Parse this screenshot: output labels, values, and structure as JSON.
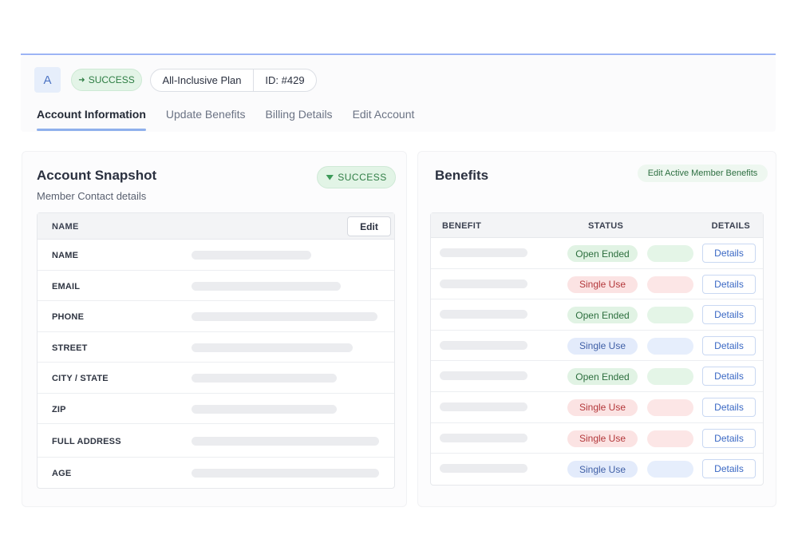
{
  "header": {
    "avatar_letter": "A",
    "status_label": "SUCCESS",
    "plan_name": "All-Inclusive Plan",
    "plan_id": "ID: #429",
    "tabs": [
      {
        "label": "Account Information",
        "active": true
      },
      {
        "label": "Update Benefits",
        "active": false
      },
      {
        "label": "Billing Details",
        "active": false
      },
      {
        "label": "Edit Account",
        "active": false
      }
    ]
  },
  "snapshot": {
    "title": "Account Snapshot",
    "subtitle": "Member Contact details",
    "status_label": "SUCCESS",
    "table_header": "NAME",
    "edit_label": "Edit",
    "rows": [
      "NAME",
      "EMAIL",
      "PHONE",
      "STREET",
      "CITY / STATE",
      "ZIP",
      "FULL ADDRESS",
      "AGE"
    ]
  },
  "benefits": {
    "title": "Benefits",
    "edit_label": "Edit Active Member Benefits",
    "columns": {
      "benefit": "BENEFIT",
      "status": "STATUS",
      "details": "DETAILS"
    },
    "rows": [
      {
        "status": "Open Ended",
        "tone": "open",
        "details": "Details"
      },
      {
        "status": "Single Use",
        "tone": "single",
        "details": "Details"
      },
      {
        "status": "Open Ended",
        "tone": "open",
        "details": "Details"
      },
      {
        "status": "Single Use",
        "tone": "singleb",
        "details": "Details"
      },
      {
        "status": "Open Ended",
        "tone": "open",
        "details": "Details"
      },
      {
        "status": "Single Use",
        "tone": "single",
        "details": "Details"
      },
      {
        "status": "Single Use",
        "tone": "single",
        "details": "Details"
      },
      {
        "status": "Single Use",
        "tone": "singleb",
        "details": "Details"
      }
    ]
  },
  "colors": {
    "accent": "#8fb0ec",
    "success": "#2d7d43",
    "danger": "#b3373a",
    "info": "#3f5fa6"
  }
}
